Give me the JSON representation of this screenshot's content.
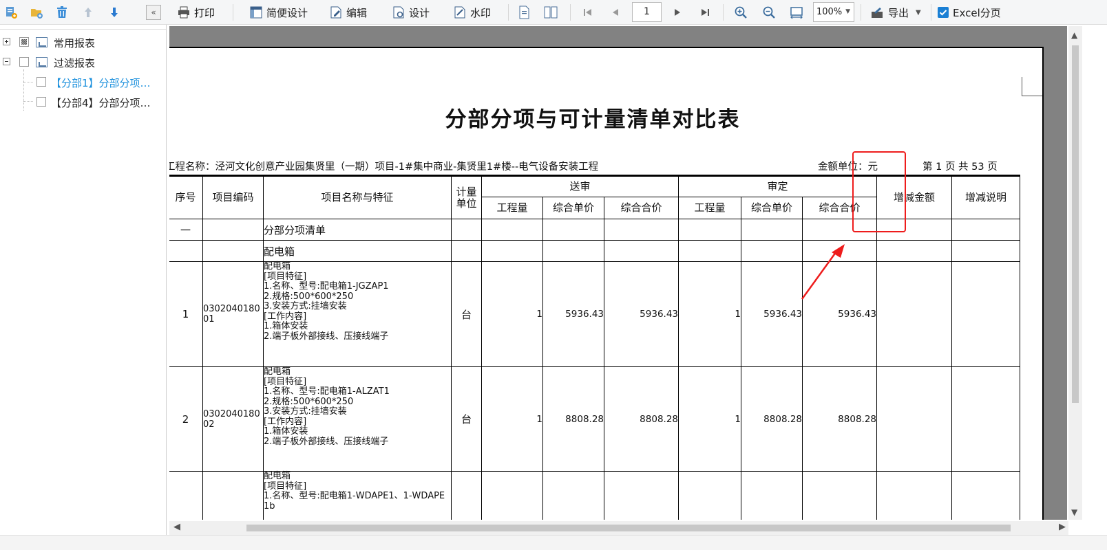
{
  "toolbar": {
    "print": "打印",
    "simple_design": "简便设计",
    "edit": "编辑",
    "design": "设计",
    "watermark": "水印",
    "page_number": "1",
    "zoom": "100%",
    "export": "导出",
    "excel_paging": "Excel分页",
    "excel_paging_checked": true
  },
  "tree": {
    "items": [
      {
        "label": "常用报表",
        "expanded": false,
        "check": "partial"
      },
      {
        "label": "过滤报表",
        "expanded": true,
        "check": "unchecked"
      },
      {
        "label": "【分部1】分部分项…",
        "selected": true,
        "check": "unchecked"
      },
      {
        "label": "【分部4】分部分项…",
        "selected": false,
        "check": "unchecked"
      }
    ]
  },
  "report": {
    "title": "分部分项与可计量清单对比表",
    "project_name": "工程名称：泾河文化创意产业园集贤里（一期）项目-1#集中商业-集贤里1#楼--电气设备安装工程",
    "amount_unit": "金额单位：元",
    "page_info": "第 1 页   共 53 页",
    "headers": {
      "seq": "序号",
      "code": "项目编码",
      "name": "项目名称与特征",
      "unit": "计量单位",
      "submitted": "送审",
      "approved": "审定",
      "qty": "工程量",
      "unit_price": "综合单价",
      "total_price": "综合合价",
      "diff_amount": "增减金额",
      "diff_note": "增减说明"
    },
    "rows": [
      {
        "seq": "一",
        "code": "",
        "name": "分部分项清单"
      },
      {
        "seq": "",
        "code": "",
        "name": "配电箱"
      },
      {
        "seq": "1",
        "code": "030204018001",
        "desc": [
          "配电箱",
          "[项目特征]",
          "1.名称、型号:配电箱1-JGZAP1",
          "2.规格:500*600*250",
          "3.安装方式:挂墙安装",
          "[工作内容]",
          "1.箱体安装",
          "2.端子板外部接线、压接线端子"
        ],
        "unit": "台",
        "s_qty": "1",
        "s_price": "5936.43",
        "s_total": "5936.43",
        "a_qty": "1",
        "a_price": "5936.43",
        "a_total": "5936.43"
      },
      {
        "seq": "2",
        "code": "030204018002",
        "desc": [
          "配电箱",
          "[项目特征]",
          "1.名称、型号:配电箱1-ALZAT1",
          "2.规格:500*600*250",
          "3.安装方式:挂墙安装",
          "[工作内容]",
          "1.箱体安装",
          "2.端子板外部接线、压接线端子"
        ],
        "unit": "台",
        "s_qty": "1",
        "s_price": "8808.28",
        "s_total": "8808.28",
        "a_qty": "1",
        "a_price": "8808.28",
        "a_total": "8808.28"
      },
      {
        "seq": "",
        "code": "",
        "desc": [
          "配电箱",
          "[项目特征]",
          "1.名称、型号:配电箱1-WDAPE1、1-WDAPE",
          "1b"
        ]
      }
    ]
  },
  "colors": {
    "accent": "#1a7fd4",
    "selected_text": "#1a8fdc",
    "annotation": "#ee1c1c"
  }
}
